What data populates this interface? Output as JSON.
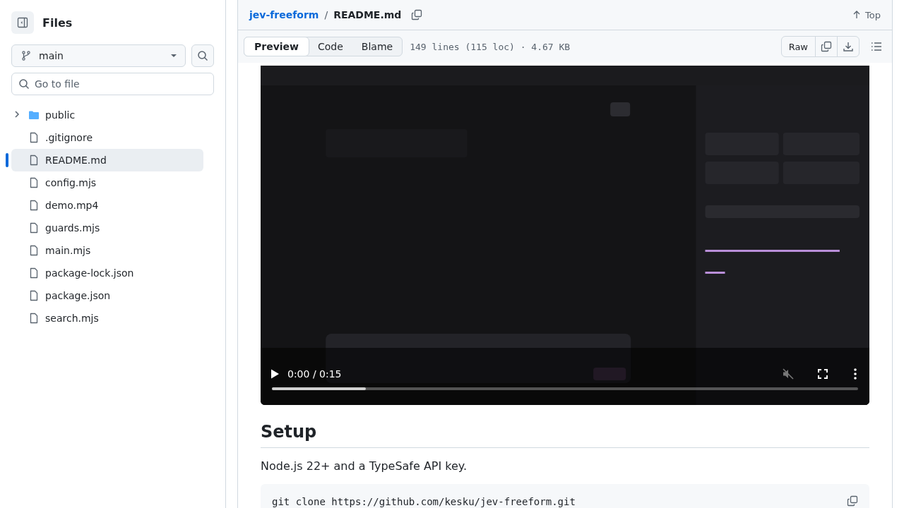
{
  "sidebar": {
    "title": "Files",
    "branch": "main",
    "search": {
      "placeholder": "Go to file"
    },
    "tree": [
      {
        "kind": "folder",
        "name": "public",
        "expanded": false,
        "selected": false
      },
      {
        "kind": "file",
        "name": ".gitignore",
        "selected": false
      },
      {
        "kind": "file",
        "name": "README.md",
        "selected": true
      },
      {
        "kind": "file",
        "name": "config.mjs",
        "selected": false
      },
      {
        "kind": "file",
        "name": "demo.mp4",
        "selected": false
      },
      {
        "kind": "file",
        "name": "guards.mjs",
        "selected": false
      },
      {
        "kind": "file",
        "name": "main.mjs",
        "selected": false
      },
      {
        "kind": "file",
        "name": "package-lock.json",
        "selected": false
      },
      {
        "kind": "file",
        "name": "package.json",
        "selected": false
      },
      {
        "kind": "file",
        "name": "search.mjs",
        "selected": false
      }
    ]
  },
  "header": {
    "repo": "jev-freeform",
    "separator": "/",
    "file": "README.md",
    "top": "Top"
  },
  "toolbar": {
    "tabs": [
      {
        "label": "Preview",
        "selected": true
      },
      {
        "label": "Code",
        "selected": false
      },
      {
        "label": "Blame",
        "selected": false
      }
    ],
    "info": "149 lines (115 loc) · 4.67 KB",
    "raw": "Raw"
  },
  "readme": {
    "video": {
      "kind": "picture",
      "time": "0:00 / 0:15",
      "level": 0.16,
      "muted": true
    },
    "heading": "Setup",
    "paragraph": "Node.js 22+ and a TypeSafe API key.",
    "code": "git clone https://github.com/kesku/jev-freeform.git"
  }
}
